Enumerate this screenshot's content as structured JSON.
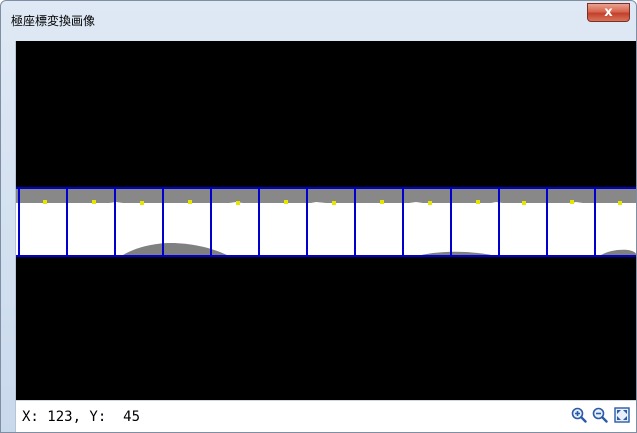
{
  "window": {
    "title": "極座標変換画像",
    "close_label": "x"
  },
  "image_view": {
    "cell_count": 13,
    "grid_color": "#0000cc",
    "background_color": "#000000",
    "band_gray": "#888888",
    "band_white": "#ffffff",
    "marker_color": "#e6e600"
  },
  "status": {
    "coordinates": "X: 123, Y:  45"
  },
  "toolbar": {
    "zoom_in_icon": "zoom-in-icon",
    "zoom_out_icon": "zoom-out-icon",
    "fit_icon": "fit-to-window-icon"
  }
}
